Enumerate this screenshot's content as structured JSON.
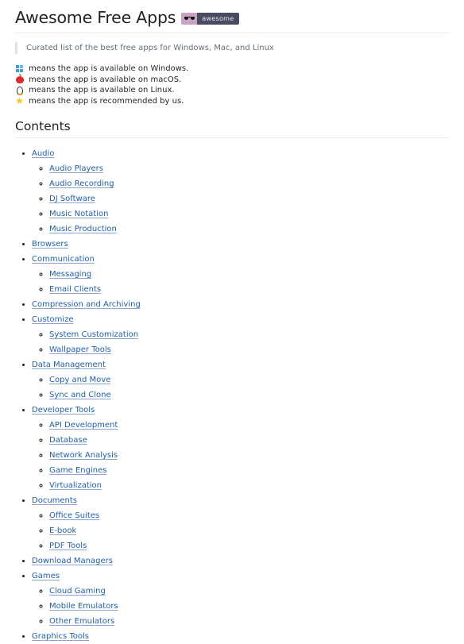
{
  "header": {
    "title": "Awesome Free Apps",
    "badge_label": "awesome"
  },
  "description": "Curated list of the best free apps for Windows, Mac, and Linux",
  "legend": [
    {
      "icon": "windows-icon",
      "text": "means the app is available on Windows."
    },
    {
      "icon": "apple-icon",
      "text": "means the app is available on macOS."
    },
    {
      "icon": "linux-penguin-icon",
      "text": "means the app is available on Linux."
    },
    {
      "icon": "star-icon",
      "text": "means the app is recommended by us."
    }
  ],
  "contents": {
    "heading": "Contents",
    "items": [
      {
        "label": "Audio",
        "children": [
          "Audio Players",
          "Audio Recording",
          "DJ Software",
          "Music Notation",
          "Music Production"
        ]
      },
      {
        "label": "Browsers",
        "children": []
      },
      {
        "label": "Communication",
        "children": [
          "Messaging",
          "Email Clients"
        ]
      },
      {
        "label": "Compression and Archiving",
        "children": []
      },
      {
        "label": "Customize",
        "children": [
          "System Customization",
          "Wallpaper Tools"
        ]
      },
      {
        "label": "Data Management",
        "children": [
          "Copy and Move",
          "Sync and Clone"
        ]
      },
      {
        "label": "Developer Tools",
        "children": [
          "API Development",
          "Database",
          "Network Analysis",
          "Game Engines",
          "Virtualization"
        ]
      },
      {
        "label": "Documents",
        "children": [
          "Office Suites",
          "E-book",
          "PDF Tools"
        ]
      },
      {
        "label": "Download Managers",
        "children": []
      },
      {
        "label": "Games",
        "children": [
          "Cloud Gaming",
          "Mobile Emulators",
          "Other Emulators"
        ]
      },
      {
        "label": "Graphics Tools",
        "children": []
      }
    ]
  }
}
